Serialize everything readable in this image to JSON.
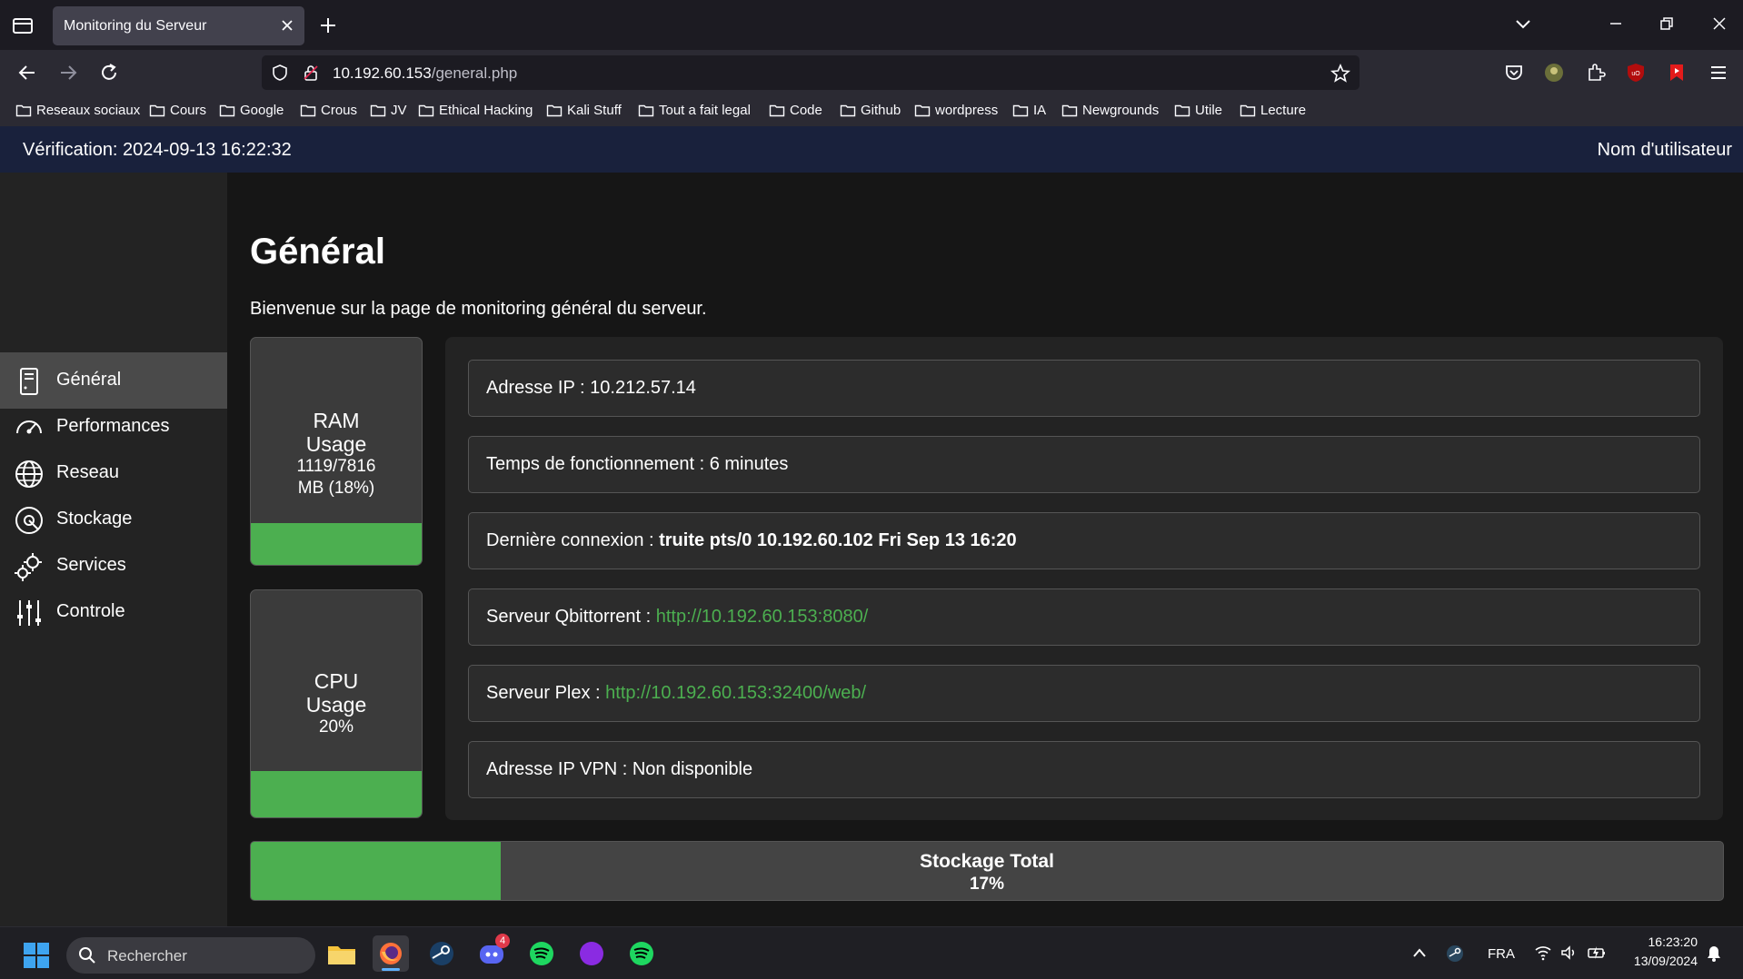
{
  "browser": {
    "tab_title": "Monitoring du Serveur",
    "url_host": "10.192.60.153",
    "url_path": "/general.php",
    "bookmarks": [
      "Reseaux sociaux",
      "Cours",
      "Google",
      "Crous",
      "JV",
      "Ethical Hacking",
      "Kali Stuff",
      "Tout a fait legal",
      "Code",
      "Github",
      "wordpress",
      "IA",
      "Newgrounds",
      "Utile",
      "Lecture"
    ]
  },
  "header": {
    "verification": "Vérification: 2024-09-13 16:22:32",
    "username": "Nom d'utilisateur"
  },
  "sidebar": {
    "items": [
      {
        "label": "Général",
        "icon": "server-icon",
        "active": true
      },
      {
        "label": "Performances",
        "icon": "speedometer-icon",
        "active": false
      },
      {
        "label": "Reseau",
        "icon": "globe-icon",
        "active": false
      },
      {
        "label": "Stockage",
        "icon": "disk-icon",
        "active": false
      },
      {
        "label": "Services",
        "icon": "gears-icon",
        "active": false
      },
      {
        "label": "Controle",
        "icon": "sliders-icon",
        "active": false
      }
    ]
  },
  "main": {
    "title": "Général",
    "subtitle": "Bienvenue sur la page de monitoring général du serveur.",
    "ram": {
      "title_line1": "RAM",
      "title_line2": "Usage",
      "value_line1": "1119/7816",
      "value_line2": "MB (18%)",
      "percent": 18
    },
    "cpu": {
      "title_line1": "CPU",
      "title_line2": "Usage",
      "value": "20%",
      "percent": 20
    },
    "info": [
      {
        "label": "Adresse IP : ",
        "value": "10.212.57.14",
        "style": "plain"
      },
      {
        "label": "Temps de fonctionnement : ",
        "value": "6 minutes",
        "style": "plain"
      },
      {
        "label": "Dernière connexion : ",
        "value": "truite pts/0 10.192.60.102 Fri Sep 13 16:20",
        "style": "bold"
      },
      {
        "label": "Serveur Qbittorrent : ",
        "value": "http://10.192.60.153:8080/",
        "style": "link"
      },
      {
        "label": "Serveur Plex : ",
        "value": "http://10.192.60.153:32400/web/",
        "style": "link"
      },
      {
        "label": "Adresse IP VPN : ",
        "value": "Non disponible",
        "style": "plain"
      }
    ],
    "storage": {
      "title": "Stockage Total",
      "value": "17%",
      "percent": 17
    }
  },
  "taskbar": {
    "search_placeholder": "Rechercher",
    "discord_badge": "4",
    "language": "FRA",
    "time": "16:23:20",
    "date": "13/09/2024"
  },
  "colors": {
    "accent_green": "#4caf50",
    "header_bg": "#19213c"
  }
}
